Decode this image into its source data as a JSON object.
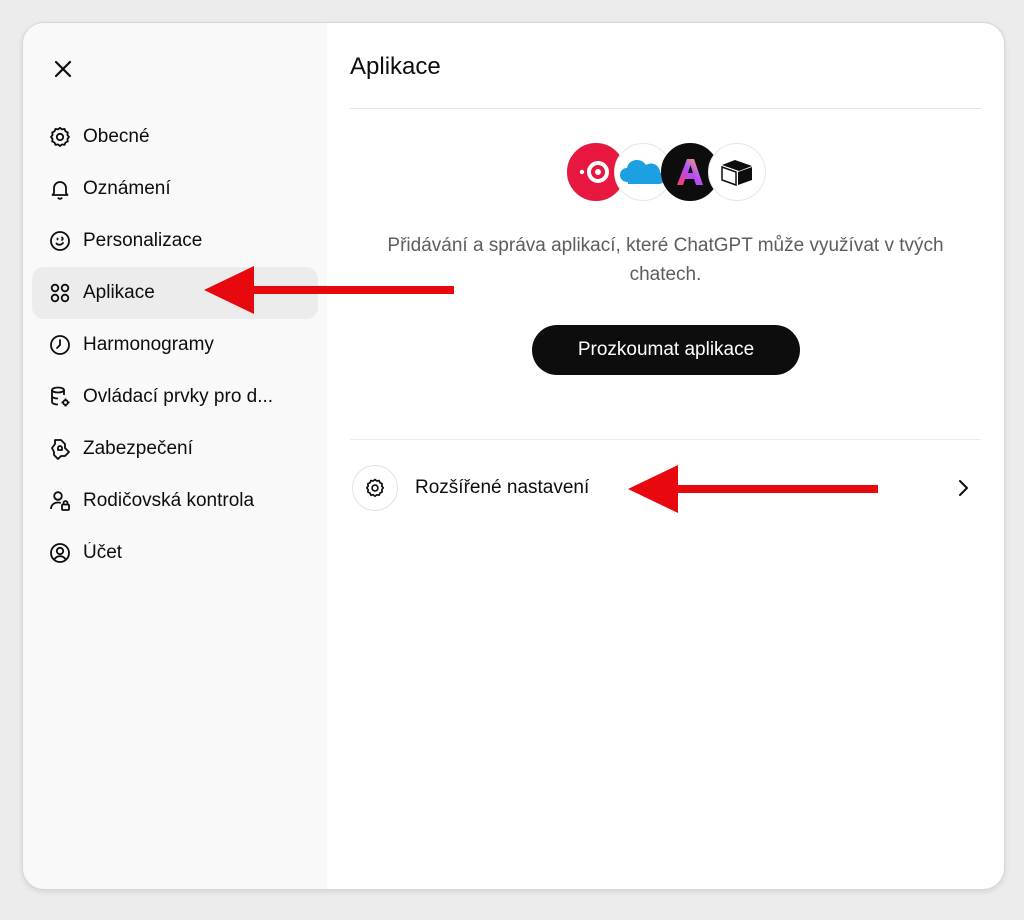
{
  "sidebar": {
    "close_icon": "close-icon",
    "items": [
      {
        "label": "Obecné",
        "icon": "gear-icon"
      },
      {
        "label": "Oznámení",
        "icon": "bell-icon"
      },
      {
        "label": "Personalizace",
        "icon": "personalization-icon"
      },
      {
        "label": "Aplikace",
        "icon": "apps-grid-icon",
        "active": true
      },
      {
        "label": "Harmonogramy",
        "icon": "clock-icon"
      },
      {
        "label": "Ovládací prvky pro d...",
        "icon": "database-gear-icon"
      },
      {
        "label": "Zabezpečení",
        "icon": "shield-lock-icon"
      },
      {
        "label": "Rodičovská kontrola",
        "icon": "parent-lock-icon"
      },
      {
        "label": "Účet",
        "icon": "user-circle-icon"
      }
    ]
  },
  "main": {
    "title": "Aplikace",
    "app_logos": [
      "red-ring-logo",
      "cloud-logo",
      "adobe-express-logo",
      "box-logo"
    ],
    "description": "Přidávání a správa aplikací, které ChatGPT může využívat v tvých chatech.",
    "explore_button": "Prozkoumat aplikace",
    "advanced_settings": {
      "label": "Rozšířené nastavení",
      "icon": "gear-icon",
      "chevron": "chevron-right-icon"
    }
  },
  "annotations": {
    "arrow_color": "#e8090f"
  },
  "colors": {
    "accent": "#0d0d0d",
    "sidebar_bg": "#f9f9f9",
    "active_bg": "#ececec"
  }
}
